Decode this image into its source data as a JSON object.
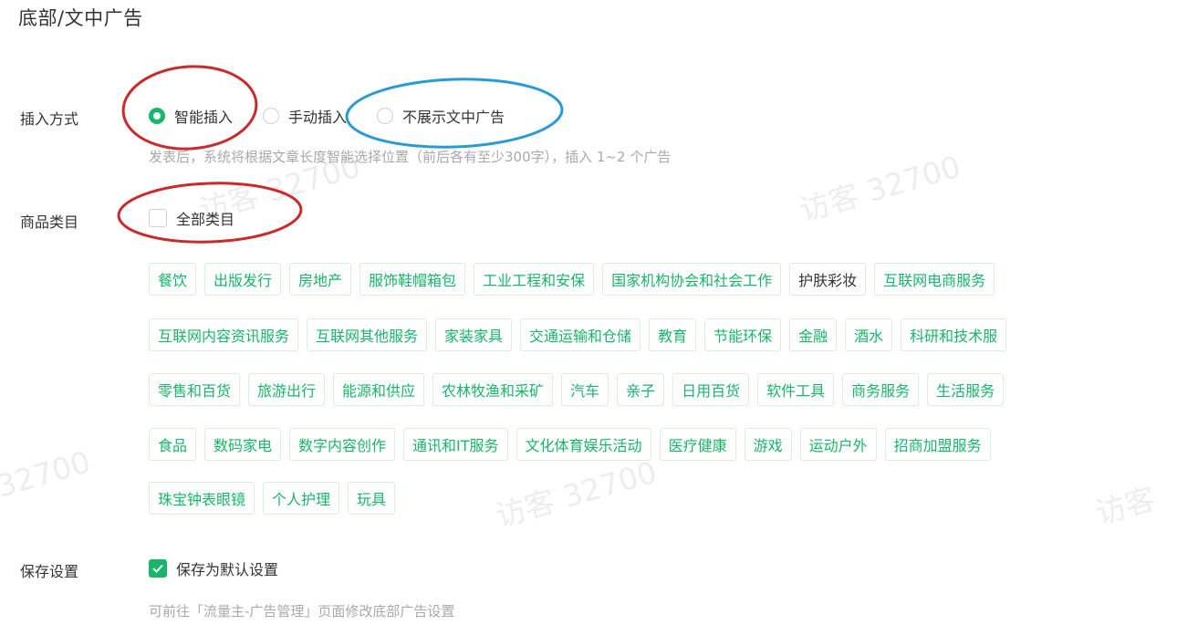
{
  "section": {
    "title": "底部/文中广告"
  },
  "insert_mode": {
    "label": "插入方式",
    "options": [
      {
        "label": "智能插入",
        "checked": true
      },
      {
        "label": "手动插入",
        "checked": false
      },
      {
        "label": "不展示文中广告",
        "checked": false
      }
    ],
    "hint": "发表后，系统将根据文章长度智能选择位置（前后各有至少300字），插入 1~2 个广告"
  },
  "category": {
    "label": "商品类目",
    "all_label": "全部类目",
    "all_checked": false,
    "tags": [
      [
        "餐饮",
        "出版发行",
        "房地产",
        "服饰鞋帽箱包",
        "工业工程和安保",
        "国家机构协会和社会工作",
        "护肤彩妆",
        "互联网电商服务"
      ],
      [
        "互联网内容资讯服务",
        "互联网其他服务",
        "家装家具",
        "交通运输和仓储",
        "教育",
        "节能环保",
        "金融",
        "酒水",
        "科研和技术服"
      ],
      [
        "零售和百货",
        "旅游出行",
        "能源和供应",
        "农林牧渔和采矿",
        "汽车",
        "亲子",
        "日用百货",
        "软件工具",
        "商务服务",
        "生活服务"
      ],
      [
        "食品",
        "数码家电",
        "数字内容创作",
        "通讯和IT服务",
        "文化体育娱乐活动",
        "医疗健康",
        "游戏",
        "运动户外",
        "招商加盟服务"
      ],
      [
        "珠宝钟表眼镜",
        "个人护理",
        "玩具"
      ]
    ]
  },
  "save_settings": {
    "label": "保存设置",
    "checkbox_label": "保存为默认设置",
    "checked": true,
    "hint": "可前往「流量主-广告管理」页面修改底部广告设置"
  },
  "watermarks": [
    "访客 32700",
    "访客 32700",
    "32700",
    "访客 32700",
    "访客"
  ],
  "colors": {
    "accent": "#19b56a",
    "annotation_red": "#cc2a2a",
    "annotation_blue": "#2a9ad6"
  }
}
